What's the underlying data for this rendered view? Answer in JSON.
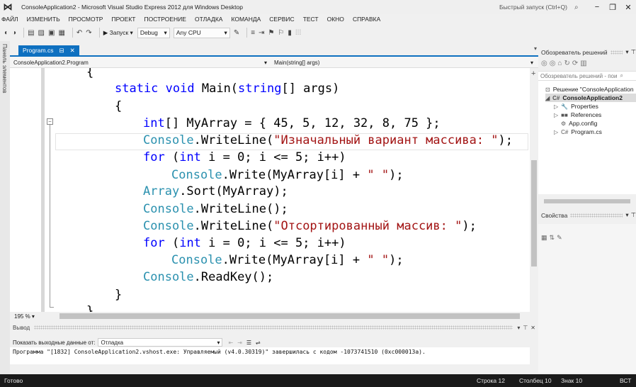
{
  "window": {
    "logo": "⋈",
    "title": "ConsoleApplication2 - Microsoft Visual Studio Express 2012 для Windows Desktop",
    "quick_launch": "Быстрый запуск (Ctrl+Q)",
    "search_icon": "search-icon",
    "buttons": {
      "minimize": "−",
      "restore": "❐",
      "close": "✕"
    }
  },
  "menu": [
    "ФАЙЛ",
    "ИЗМЕНИТЬ",
    "ПРОСМОТР",
    "ПРОЕКТ",
    "ПОСТРОЕНИЕ",
    "ОТЛАДКА",
    "КОМАНДА",
    "СЕРВИС",
    "ТЕСТ",
    "ОКНО",
    "СПРАВКА"
  ],
  "toolbar": {
    "start_label": "▶ Запуск ▾",
    "config": "Debug",
    "platform": "Any CPU"
  },
  "toolbox_label": "Панель элементов",
  "editor": {
    "tab_label": "Program.cs",
    "tab_pin": "⊟",
    "tab_close": "✕",
    "nav_left": "ConsoleApplication2.Program",
    "nav_right": "Main(string[] args)",
    "lines": [
      {
        "parts": [
          {
            "t": "{",
            "c": ""
          }
        ]
      },
      {
        "parts": [
          {
            "t": "static",
            "c": "kw"
          },
          {
            "t": " ",
            "c": ""
          },
          {
            "t": "void",
            "c": "kw"
          },
          {
            "t": " Main(",
            "c": ""
          },
          {
            "t": "string",
            "c": "kw"
          },
          {
            "t": "[] args)",
            "c": ""
          }
        ]
      },
      {
        "parts": [
          {
            "t": "{",
            "c": ""
          }
        ]
      },
      {
        "parts": [
          {
            "t": "int",
            "c": "kw"
          },
          {
            "t": "[] MyArray = { 45, 5, 12, 32, 8, 75 };",
            "c": ""
          }
        ]
      },
      {
        "parts": [
          {
            "t": "Console",
            "c": "cls"
          },
          {
            "t": ".WriteLine(",
            "c": ""
          },
          {
            "t": "\"Изначальный вариант массива: \"",
            "c": "str"
          },
          {
            "t": ");",
            "c": ""
          }
        ]
      },
      {
        "parts": [
          {
            "t": "for",
            "c": "kw"
          },
          {
            "t": " (",
            "c": ""
          },
          {
            "t": "int",
            "c": "kw"
          },
          {
            "t": " i = 0; i <= 5; i++)",
            "c": ""
          }
        ]
      },
      {
        "parts": [
          {
            "t": "Console",
            "c": "cls"
          },
          {
            "t": ".Write(MyArray[i] + ",
            "c": ""
          },
          {
            "t": "\" \"",
            "c": "str"
          },
          {
            "t": ");",
            "c": ""
          }
        ]
      },
      {
        "parts": [
          {
            "t": "Array",
            "c": "cls"
          },
          {
            "t": ".Sort(MyArray);",
            "c": ""
          }
        ]
      },
      {
        "parts": [
          {
            "t": "Console",
            "c": "cls"
          },
          {
            "t": ".WriteLine();",
            "c": ""
          }
        ]
      },
      {
        "parts": [
          {
            "t": "Console",
            "c": "cls"
          },
          {
            "t": ".WriteLine(",
            "c": ""
          },
          {
            "t": "\"Отсортированный массив: \"",
            "c": "str"
          },
          {
            "t": ");",
            "c": ""
          }
        ]
      },
      {
        "parts": [
          {
            "t": "for",
            "c": "kw"
          },
          {
            "t": " (",
            "c": ""
          },
          {
            "t": "int",
            "c": "kw"
          },
          {
            "t": " i = 0; i <= 5; i++)",
            "c": ""
          }
        ]
      },
      {
        "parts": [
          {
            "t": "Console",
            "c": "cls"
          },
          {
            "t": ".Write(MyArray[i] + ",
            "c": ""
          },
          {
            "t": "\" \"",
            "c": "str"
          },
          {
            "t": ");",
            "c": ""
          }
        ]
      },
      {
        "parts": [
          {
            "t": "Console",
            "c": "cls"
          },
          {
            "t": ".ReadKey();",
            "c": ""
          }
        ]
      },
      {
        "parts": [
          {
            "t": "}",
            "c": ""
          }
        ]
      },
      {
        "parts": [
          {
            "t": "}",
            "c": ""
          }
        ]
      }
    ],
    "zoom": "195 % ▾"
  },
  "output": {
    "title": "Вывод",
    "show_from_label": "Показать выходные данные от:",
    "source": "Отладка",
    "text": "Программа \"[1832] ConsoleApplication2.vshost.exe: Управляемый (v4.0.30319)\" завершилась с кодом -1073741510 (0xc000013a)."
  },
  "solution_explorer": {
    "title": "Обозреватель решений",
    "search_placeholder": "Обозреватель решений - пои",
    "items": [
      {
        "label": "Решение \"ConsoleApplication",
        "icon": "⊡",
        "arrow": ""
      },
      {
        "label": "ConsoleApplication2",
        "icon": "C#",
        "arrow": "◢"
      },
      {
        "label": "Properties",
        "icon": "🔧",
        "arrow": "▷"
      },
      {
        "label": "References",
        "icon": "■■",
        "arrow": "▷"
      },
      {
        "label": "App.config",
        "icon": "⚙",
        "arrow": ""
      },
      {
        "label": "Program.cs",
        "icon": "C#",
        "arrow": "▷"
      }
    ]
  },
  "properties": {
    "title": "Свойства"
  },
  "status": {
    "ready": "Готово",
    "line": "Строка 12",
    "col": "Столбец 10",
    "char": "Знак 10",
    "mode": "ВСТ"
  }
}
